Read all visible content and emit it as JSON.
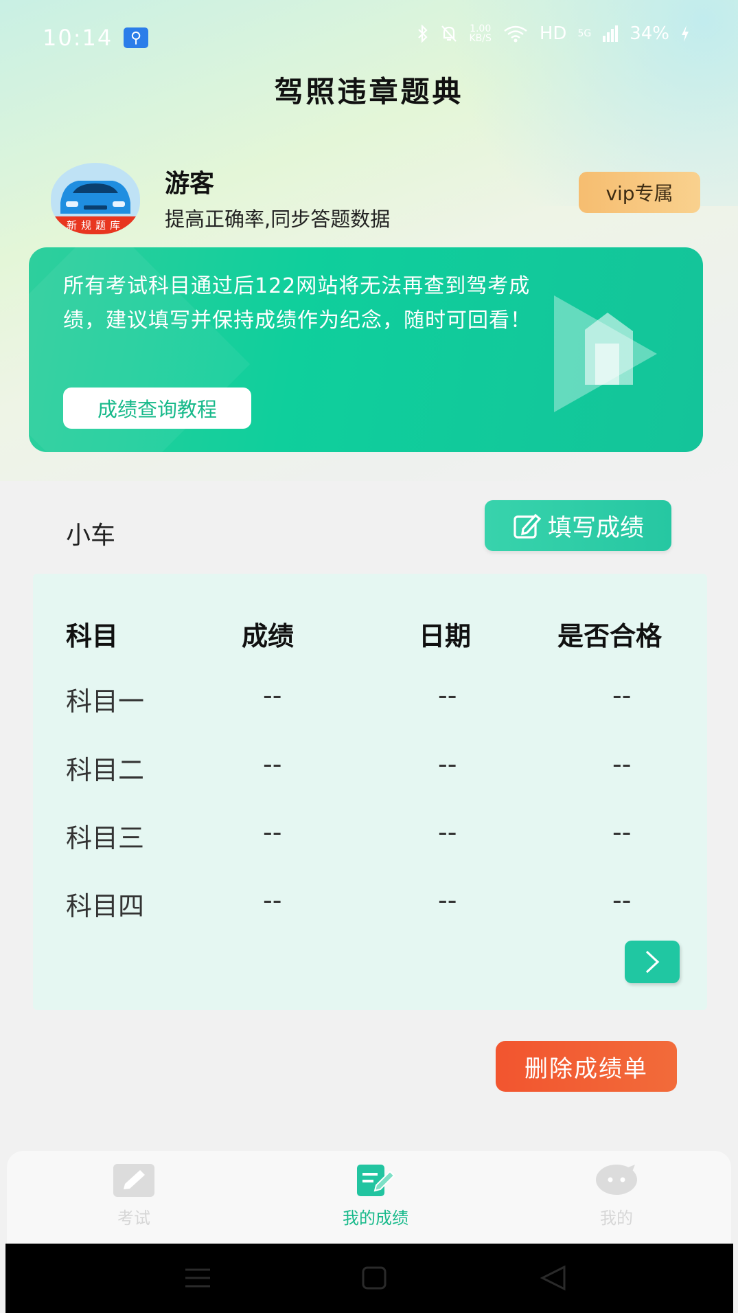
{
  "status_bar": {
    "time": "10:14",
    "net_speed_value": "1.00",
    "net_speed_unit": "KB/S",
    "hd_label": "HD",
    "signal_label": "5G",
    "battery": "34%"
  },
  "header": {
    "title": "驾照违章题典"
  },
  "profile": {
    "avatar_ribbon": "新规题库",
    "name": "游客",
    "description": "提高正确率,同步答题数据",
    "vip_label": "vip专属"
  },
  "banner": {
    "text": "所有考试科目通过后122网站将无法再查到驾考成绩，建议填写并保持成绩作为纪念，随时可回看！",
    "button_label": "成绩查询教程"
  },
  "car_section": {
    "label": "小车",
    "fill_button_label": "填写成绩"
  },
  "score_table": {
    "headers": [
      "科目",
      "成绩",
      "日期",
      "是否合格"
    ],
    "rows": [
      [
        "科目一",
        "--",
        "--",
        "--"
      ],
      [
        "科目二",
        "--",
        "--",
        "--"
      ],
      [
        "科目三",
        "--",
        "--",
        "--"
      ],
      [
        "科目四",
        "--",
        "--",
        "--"
      ]
    ]
  },
  "delete_button_label": "删除成绩单",
  "bottom_nav": {
    "items": [
      {
        "label": "考试",
        "icon": "pencil-icon"
      },
      {
        "label": "我的成绩",
        "icon": "edit-note-icon"
      },
      {
        "label": "我的",
        "icon": "chat-face-icon"
      }
    ],
    "active_index": 1
  },
  "colors": {
    "accent_green": "#14c49a",
    "vip_orange": "#f6bd70",
    "delete_red": "#f2552f"
  }
}
